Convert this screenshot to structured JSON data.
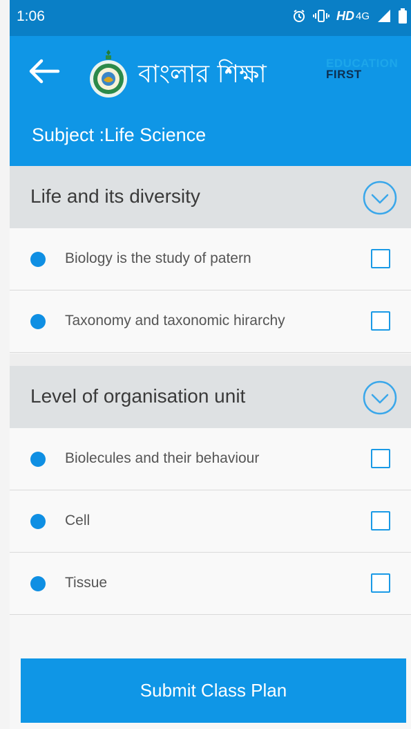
{
  "status_bar": {
    "time": "1:06",
    "network_hd": "HD",
    "network_type": "4G",
    "icons": [
      "alarm-icon",
      "vibrate-icon",
      "signal-icon",
      "battery-icon"
    ]
  },
  "app_bar": {
    "title_bangla": "বাংলার শিক্ষা",
    "brand_top": "EDUCATION",
    "brand_bottom": "FIRST",
    "subject": "Subject :Life Science",
    "color": "#0f96e6",
    "icons": [
      "back-arrow-icon",
      "state-emblem-logo"
    ]
  },
  "sections": [
    {
      "title": "Life and its diversity",
      "topics": [
        {
          "label": "Biology is the study of patern",
          "checked": false
        },
        {
          "label": "Taxonomy and taxonomic hirarchy",
          "checked": false
        }
      ]
    },
    {
      "title": "Level of organisation unit",
      "topics": [
        {
          "label": "Biolecules and their behaviour",
          "checked": false
        },
        {
          "label": "Cell",
          "checked": false
        },
        {
          "label": "Tissue",
          "checked": false
        }
      ]
    }
  ],
  "submit_label": "Submit Class Plan",
  "colors": {
    "accent": "#0f96e6",
    "section_bg": "#dee1e3",
    "bullet": "#0f8fe3"
  }
}
